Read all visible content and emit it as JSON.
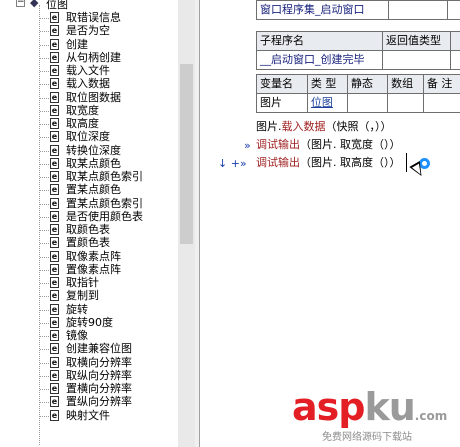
{
  "tree": {
    "root_label": "位图",
    "items": [
      "取错误信息",
      "是否为空",
      "创建",
      "从句柄创建",
      "载入文件",
      "载入数据",
      "取位图数据",
      "取宽度",
      "取高度",
      "取位深度",
      "转换位深度",
      "取某点颜色",
      "取某点颜色索引",
      "置某点颜色",
      "置某点颜色索引",
      "是否使用颜色表",
      "取颜色表",
      "置颜色表",
      "取像素点阵",
      "置像素点阵",
      "取指针",
      "复制到",
      "旋转",
      "旋转90度",
      "镜像",
      "创建兼容位图",
      "取横向分辨率",
      "取纵向分辨率",
      "置横向分辨率",
      "置纵向分辨率",
      "映射文件"
    ]
  },
  "editor": {
    "program_set_table": {
      "name": "窗口程序集_启动窗口",
      "extra_cols": [
        "",
        ""
      ]
    },
    "subroutine_table": {
      "headers": [
        "子程序名",
        "返回值类型",
        ""
      ],
      "row": [
        "__启动窗口_创建完毕",
        "",
        ""
      ]
    },
    "variable_table": {
      "headers": [
        "变量名",
        "类 型",
        "静态",
        "数组",
        "备 注"
      ],
      "row": [
        "图片",
        "位图",
        "",
        "",
        ""
      ]
    },
    "code_lines": [
      {
        "obj": "图片.",
        "fn": "载入数据",
        "args": "（快照（，））",
        "markers": ""
      },
      {
        "obj": "",
        "fn": "调试输出",
        "args": "（图片. 取宽度（））",
        "markers": "»"
      },
      {
        "obj": "",
        "fn": "调试输出",
        "args": "（图片. 取高度（））",
        "markers": "↓ +»"
      }
    ]
  },
  "watermark": {
    "brand_red": "asp",
    "brand_gray": "ku",
    "domain_suffix": ".com",
    "subtitle": "免费网络源码下载站"
  },
  "colors": {
    "tree_bg": "#ffffff",
    "table_header": "#e8ebf0",
    "code_function": "#a02222",
    "marker_blue": "#1a3fae",
    "watermark_red": "#e31e24"
  }
}
